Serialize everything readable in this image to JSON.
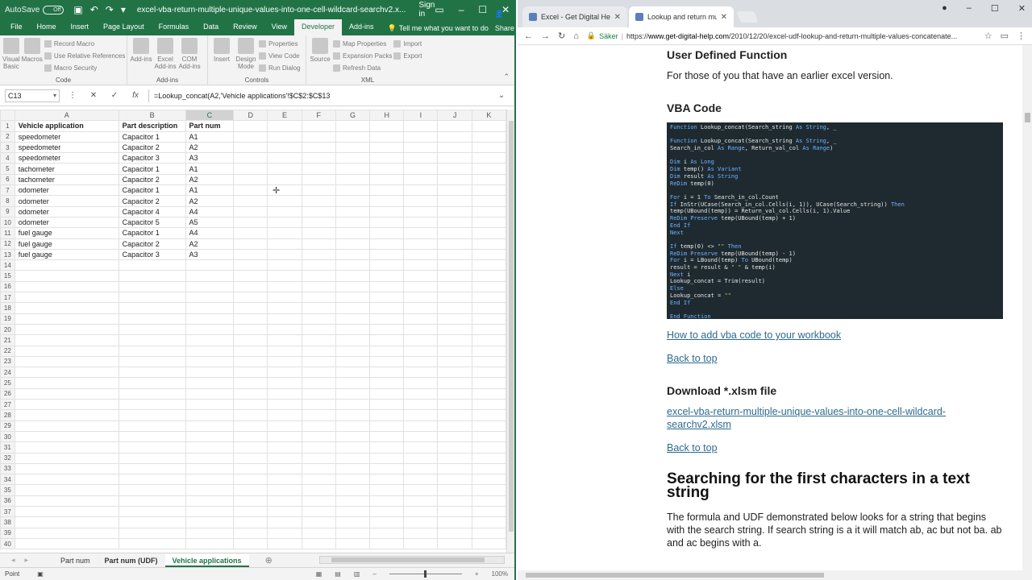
{
  "excel": {
    "title": {
      "autosave": "AutoSave",
      "toggle": "Off",
      "filename": "excel-vba-return-multiple-unique-values-into-one-cell-wildcard-searchv2.x...",
      "signin": "Sign in"
    },
    "tabs": [
      "File",
      "Home",
      "Insert",
      "Page Layout",
      "Formulas",
      "Data",
      "Review",
      "View",
      "Developer",
      "Add-ins"
    ],
    "tell_me": "Tell me what you want to do",
    "share": "Share",
    "ribbon": {
      "code_group": "Code",
      "visual_basic": "Visual Basic",
      "macros": "Macros",
      "record_macro": "Record Macro",
      "relative_refs": "Use Relative References",
      "macro_security": "Macro Security",
      "addins_group": "Add-ins",
      "addins": "Add-ins",
      "excel_addins": "Excel Add-ins",
      "com_addins": "COM Add-ins",
      "controls_group": "Controls",
      "insert": "Insert",
      "design_mode": "Design Mode",
      "properties": "Properties",
      "view_code": "View Code",
      "run_dialog": "Run Dialog",
      "xml_group": "XML",
      "source": "Source",
      "map_properties": "Map Properties",
      "expansion_packs": "Expansion Packs",
      "refresh_data": "Refresh Data",
      "import": "Import",
      "export": "Export"
    },
    "name_box": "C13",
    "formula": "=Lookup_concat(A2,'Vehicle applications'!$C$2:$C$13",
    "columns": [
      "A",
      "B",
      "C",
      "D",
      "E",
      "F",
      "G",
      "H",
      "I",
      "J",
      "K"
    ],
    "header_row": [
      "Vehicle application",
      "Part description",
      "Part num"
    ],
    "rows": [
      [
        "speedometer",
        "Capacitor 1",
        "A1"
      ],
      [
        "speedometer",
        "Capacitor 2",
        "A2"
      ],
      [
        "speedometer",
        "Capacitor 3",
        "A3"
      ],
      [
        "tachometer",
        "Capacitor 1",
        "A1"
      ],
      [
        "tachometer",
        "Capacitor 2",
        "A2"
      ],
      [
        "odometer",
        "Capacitor 1",
        "A1"
      ],
      [
        "odometer",
        "Capacitor 2",
        "A2"
      ],
      [
        "odometer",
        "Capacitor 4",
        "A4"
      ],
      [
        "odometer",
        "Capacitor 5",
        "A5"
      ],
      [
        "fuel gauge",
        "Capacitor 1",
        "A4"
      ],
      [
        "fuel gauge",
        "Capacitor 2",
        "A2"
      ],
      [
        "fuel gauge",
        "Capacitor 3",
        "A3"
      ]
    ],
    "row_count": 40,
    "sheet_tabs": [
      "Part num",
      "Part num (UDF)",
      "Vehicle applications"
    ],
    "status": "Point",
    "zoom": "100%"
  },
  "chrome": {
    "tabs": [
      "Excel - Get Digital Help",
      "Lookup and return multi"
    ],
    "secure_label": "Säker",
    "url_scheme": "https://",
    "url_host": "www.get-digital-help.com",
    "url_path": "/2010/12/20/excel-udf-lookup-and-return-multiple-values-concatenate...",
    "content": {
      "h_udf": "User Defined Function",
      "p_udf": "For those of you that have an earlier excel version.",
      "h_vba": "VBA Code",
      "link_add_vba": "How to add vba code to your workbook",
      "back_to_top": "Back to top",
      "h_download": "Download *.xlsm file",
      "link_file": "excel-vba-return-multiple-unique-values-into-one-cell-wildcard-searchv2.xlsm",
      "h_search": "Searching for the first characters in a text string",
      "p_search": "The formula and UDF demonstrated below looks for a string that begins with the search string. If search string is a it will match ab, ac but not ba. ab and ac begins with a."
    },
    "code_lines": [
      "Function Lookup_concat(Search_string As String, _",
      "",
      "Function Lookup_concat(Search_string As String, _",
      "Search_in_col As Range, Return_val_col As Range)",
      "",
      "Dim i As Long",
      "Dim temp() As Variant",
      "Dim result As String",
      "ReDim temp(0)",
      "",
      "For i = 1 To Search_in_col.Count",
      "If InStr(UCase(Search_in_col.Cells(i, 1)), UCase(Search_string)) Then",
      "temp(UBound(temp)) = Return_val_col.Cells(i, 1).Value",
      "ReDim Preserve temp(UBound(temp) + 1)",
      "End If",
      "Next",
      "",
      "If temp(0) <> \"\" Then",
      "ReDim Preserve temp(UBound(temp) - 1)",
      "For i = LBound(temp) To UBound(temp)",
      "result = result & \" \" & temp(i)",
      "Next i",
      "Lookup_concat = Trim(result)",
      "Else",
      "Lookup_concat = \"\"",
      "End If",
      "",
      "End Function"
    ]
  }
}
